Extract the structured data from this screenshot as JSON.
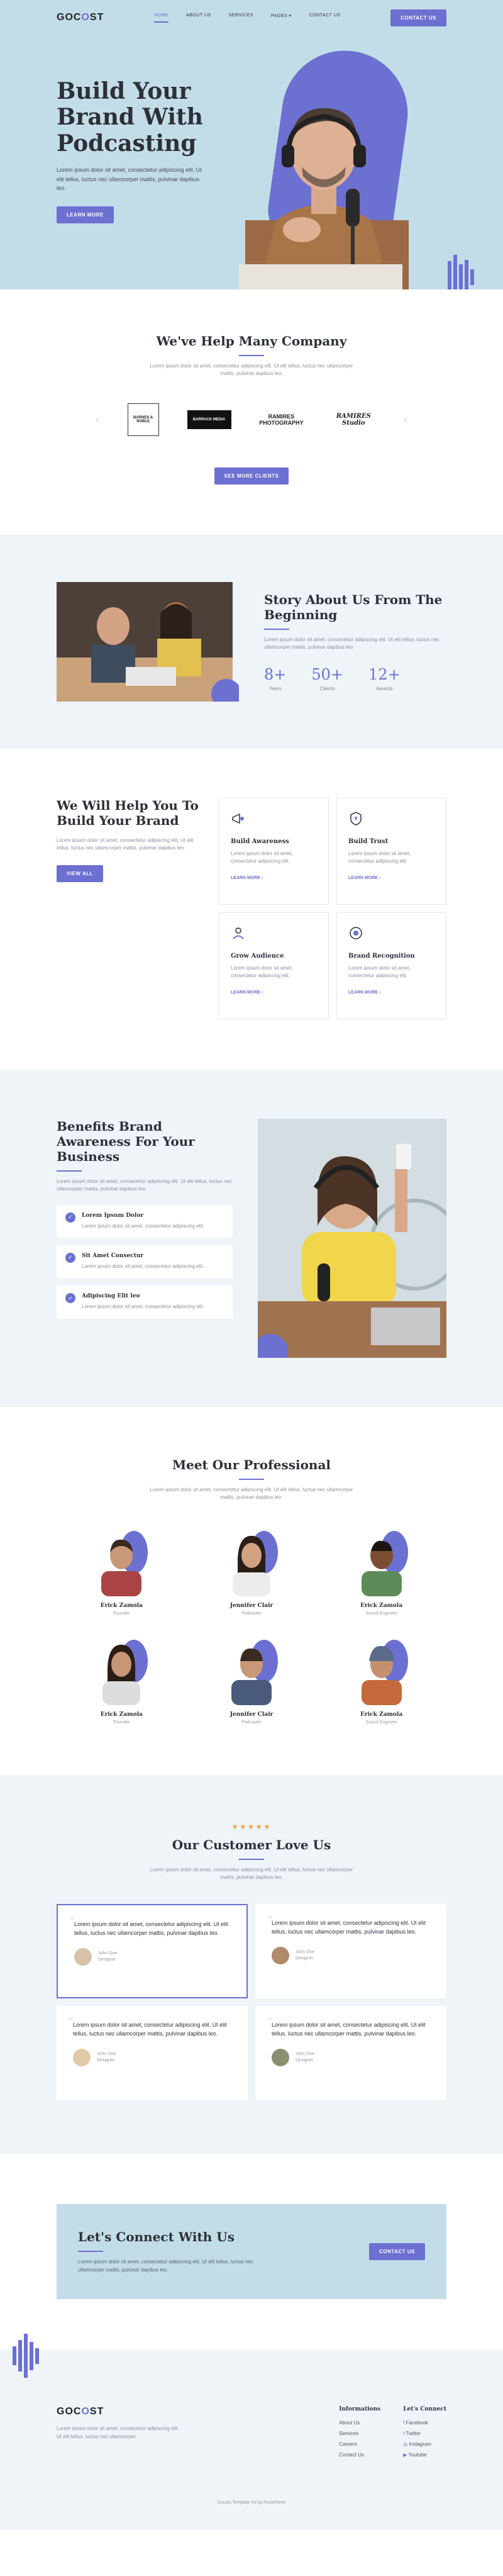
{
  "brand": {
    "prefix": "GOC",
    "mark": "O",
    "suffix": "ST"
  },
  "nav": {
    "items": [
      "HOME",
      "ABOUT US",
      "SERVICES",
      "PAGES",
      "CONTACT US"
    ],
    "cta": "CONTACT US"
  },
  "hero": {
    "title": "Build Your Brand With Podcasting",
    "text": "Lorem ipsum dolor sit amet, consectetur adipiscing elit. Ut elit tellus, luctus nec ullamcorper mattis, pulvinar dapibus leo.",
    "button": "LEARN MORE"
  },
  "clients": {
    "title": "We've Help Many Company",
    "text": "Lorem ipsum dolor sit amet, consectetur adipiscing elit. Ut elit tellus, luctus nec ullamcorper mattis, pulvinar dapibus leo.",
    "logos": [
      "BARNES & NOBLE",
      "BARRACK MEDIA",
      "RAMIRES PHOTOGRAPHY",
      "RAMIRES Studio"
    ],
    "button": "SEE MORE CLIENTS"
  },
  "about": {
    "title": "Story About Us From The Beginning",
    "text": "Lorem ipsum dolor sit amet, consectetur adipiscing elit. Ut elit tellus, luctus nec ullamcorper mattis, pulvinar dapibus leo.",
    "stats": [
      {
        "num": "8+",
        "label": "Years"
      },
      {
        "num": "50+",
        "label": "Clients"
      },
      {
        "num": "12+",
        "label": "Awards"
      }
    ]
  },
  "services": {
    "title": "We Will Help You To Build Your Brand",
    "text": "Lorem ipsum dolor sit amet, consectetur adipiscing elit. Ut elit tellus, luctus nec ullamcorper mattis, pulvinar dapibus leo.",
    "button": "VIEW ALL",
    "items": [
      {
        "title": "Build Awareness",
        "text": "Lorem ipsum dolor sit amet, consectetur adipiscing elit.",
        "more": "LEARN MORE"
      },
      {
        "title": "Build Trust",
        "text": "Lorem ipsum dolor sit amet, consectetur adipiscing elit.",
        "more": "LEARN MORE"
      },
      {
        "title": "Grow Audience",
        "text": "Lorem ipsum dolor sit amet, consectetur adipiscing elit.",
        "more": "LEARN MORE"
      },
      {
        "title": "Brand Recognition",
        "text": "Lorem ipsum dolor sit amet, consectetur adipiscing elit.",
        "more": "LEARN MORE"
      }
    ]
  },
  "benefits": {
    "title": "Benefits Brand Awareness For Your Business",
    "text": "Lorem ipsum dolor sit amet, consectetur adipiscing elit. Ut elit tellus, luctus nec ullamcorper mattis, pulvinar dapibus leo.",
    "items": [
      {
        "title": "Lorem Ipsum Dolor",
        "text": "Lorem ipsum dolor sit amet, consectetur adipiscing elit."
      },
      {
        "title": "Sit Amet Consectur",
        "text": "Lorem ipsum dolor sit amet, consectetur adipiscing elit."
      },
      {
        "title": "Adipiscing Elit leo",
        "text": "Lorem ipsum dolor sit amet, consectetur adipiscing elit."
      }
    ]
  },
  "team": {
    "title": "Meet Our Professional",
    "text": "Lorem ipsum dolor sit amet, consectetur adipiscing elit. Ut elit tellus, luctus nec ullamcorper mattis, pulvinar dapibus leo.",
    "members": [
      {
        "name": "Erick Zamola",
        "role": "Founder"
      },
      {
        "name": "Jennifer Clair",
        "role": "Podcaster"
      },
      {
        "name": "Erick Zamola",
        "role": "Sound Engineer"
      },
      {
        "name": "Erick Zamola",
        "role": "Founder"
      },
      {
        "name": "Jennifer Clair",
        "role": "Podcaster"
      },
      {
        "name": "Erick Zamola",
        "role": "Sound Engineer"
      }
    ]
  },
  "testimonials": {
    "stars": "★★★★★",
    "title": "Our Customer Love Us",
    "text": "Lorem ipsum dolor sit amet, consectetur adipiscing elit. Ut elit tellus, luctus nec ullamcorper mattis, pulvinar dapibus leo.",
    "items": [
      {
        "quote": "Lorem ipsum dolor sit amet, consectetur adipiscing elit. Ut elit tellus, luctus nec ullamcorper mattis, pulvinar dapibus leo.",
        "name": "John Doe",
        "role": "Designer"
      },
      {
        "quote": "Lorem ipsum dolor sit amet, consectetur adipiscing elit. Ut elit tellus, luctus nec ullamcorper mattis, pulvinar dapibus leo.",
        "name": "John Doe",
        "role": "Designer"
      },
      {
        "quote": "Lorem ipsum dolor sit amet, consectetur adipiscing elit. Ut elit tellus, luctus nec ullamcorper mattis, pulvinar dapibus leo.",
        "name": "John Doe",
        "role": "Designer"
      },
      {
        "quote": "Lorem ipsum dolor sit amet, consectetur adipiscing elit. Ut elit tellus, luctus nec ullamcorper mattis, pulvinar dapibus leo.",
        "name": "John Doe",
        "role": "Designer"
      }
    ]
  },
  "cta": {
    "title": "Let's Connect With Us",
    "text": "Lorem ipsum dolor sit amet, consectetur adipiscing elit. Ut elit tellus, luctus nec ullamcorper mattis, pulvinar dapibus leo.",
    "button": "CONTACT US"
  },
  "footer": {
    "text": "Lorem ipsum dolor sit amet, consectetur adipiscing elit. Ut elit tellus, luctus nec ullamcorper.",
    "info_title": "Informations",
    "info_links": [
      "About Us",
      "Services",
      "Careers",
      "Contact Us"
    ],
    "connect_title": "Let's Connect",
    "connect_links": [
      "Facebook",
      "Twitter",
      "Instagram",
      "Youtube"
    ],
    "copyright": "Gocast Template Kit by Rocktheme"
  },
  "colors": {
    "accent": "#6c70d1",
    "hero_bg": "#c3dde8",
    "section_bg": "#eef4f8"
  }
}
